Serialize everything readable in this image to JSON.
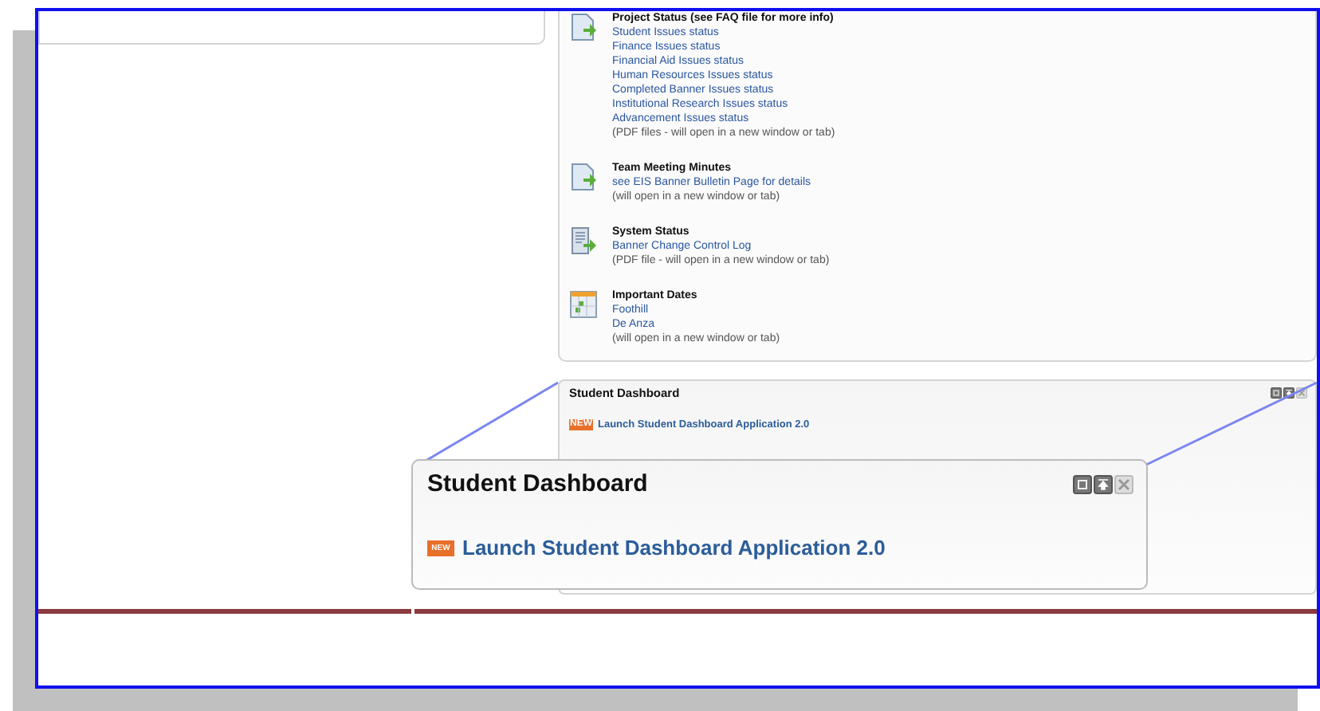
{
  "status_panel": {
    "sections": [
      {
        "kind": "document",
        "title": "Project Status (see FAQ file for more info)",
        "links": [
          "Student Issues status",
          "Finance Issues status",
          "Financial Aid Issues status",
          "Human Resources Issues status",
          "Completed Banner Issues status",
          "Institutional Research Issues status",
          "Advancement Issues status"
        ],
        "note": "(PDF files - will open in a new window or tab)"
      },
      {
        "kind": "document",
        "title": "Team Meeting Minutes",
        "links": [
          "see EIS Banner Bulletin Page for details"
        ],
        "note": "(will open in a new window or tab)"
      },
      {
        "kind": "list",
        "title": "System Status",
        "links": [
          "Banner Change Control Log"
        ],
        "note": "(PDF file - will open in a new window or tab)"
      },
      {
        "kind": "calendar",
        "title": "Important Dates",
        "links": [
          "Foothill",
          "De Anza"
        ],
        "note": "(will open in a new window or tab)"
      }
    ]
  },
  "dashboard_panel": {
    "title": "Student Dashboard",
    "badge": "NEW",
    "link": "Launch Student Dashboard Application 2.0"
  },
  "zoom_callout": {
    "title": "Student Dashboard",
    "badge": "NEW",
    "link": "Launch Student Dashboard Application 2.0"
  }
}
